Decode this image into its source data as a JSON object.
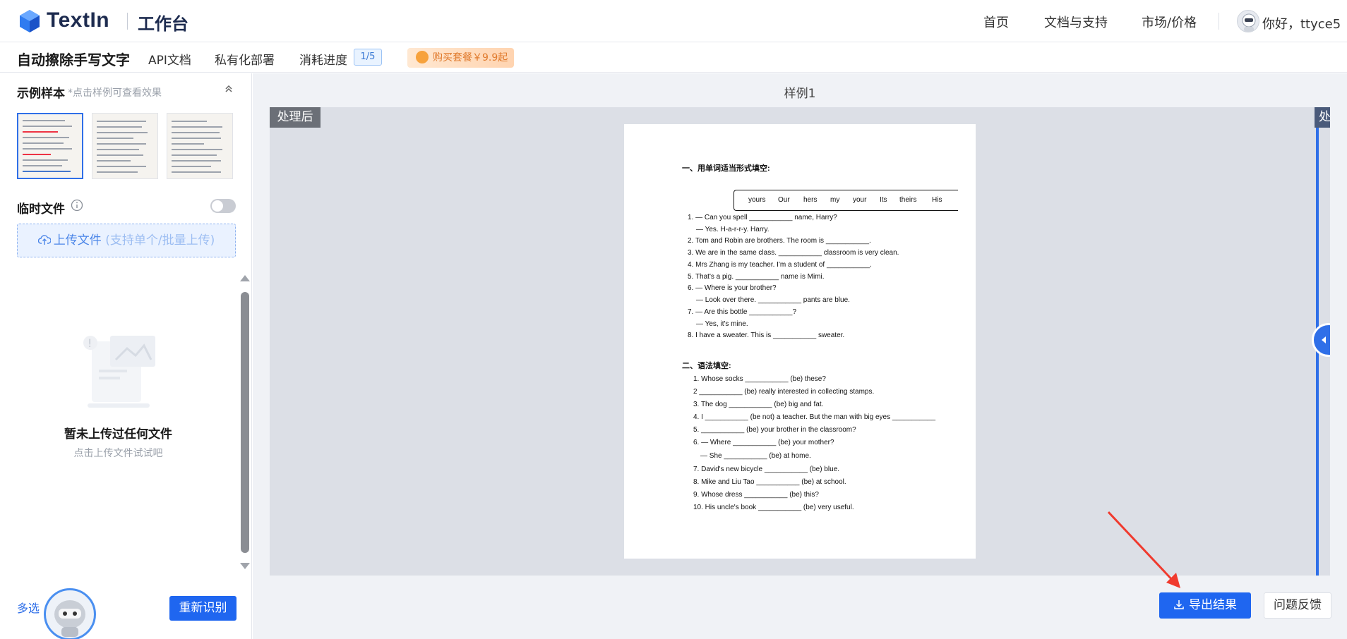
{
  "header": {
    "brand": "TextIn",
    "subtitle": "工作台",
    "nav": [
      "首页",
      "文档与支持",
      "市场/价格"
    ],
    "greeting": "你好，ttyce5"
  },
  "subheader": {
    "title": "自动擦除手写文字",
    "links": [
      "API文档",
      "私有化部署",
      "消耗进度"
    ],
    "progress": "1/5",
    "buy_label": "购买套餐￥9.9起"
  },
  "sidebar": {
    "samples_title": "示例样本",
    "samples_hint": "*点击样例可查看效果",
    "temp_files_title": "临时文件",
    "temp_toggle_on": false,
    "upload_label": "上传文件",
    "upload_note": "(支持单个/批量上传)",
    "empty_title": "暂未上传过任何文件",
    "empty_subtitle": "点击上传文件试试吧",
    "multi_select": "多选",
    "re_recognize": "重新识别"
  },
  "main": {
    "sample_title": "样例1",
    "badge_after": "处理后",
    "badge_before": "处",
    "export_button": "导出结果",
    "feedback_button": "问题反馈"
  },
  "document": {
    "section1": "一、用单词适当形式填空:",
    "word_bank": [
      "yours",
      "Our",
      "hers",
      "my",
      "your",
      "Its",
      "theirs",
      "His"
    ],
    "lines1": [
      "1. — Can you spell ___________ name, Harry?",
      "— Yes. H-a-r-r-y. Harry.",
      "2. Tom and Robin are brothers. The room is ___________.",
      "3. We are in the same class. ___________ classroom is very clean.",
      "4. Mrs Zhang is my teacher. I'm a student of ___________.",
      "5. That's a pig. ___________ name is Mimi.",
      "6. — Where is your brother?",
      "— Look over there. ___________ pants are blue.",
      "7. — Are this bottle ___________?",
      "— Yes, it's mine.",
      "8. I have a sweater. This is ___________ sweater."
    ],
    "section2": "二、语法填空:",
    "lines2": [
      "1. Whose socks ___________ (be) these?",
      "2 ___________ (be) really interested in collecting stamps.",
      "3. The dog ___________ (be) big and fat.",
      "4. I ___________ (be not) a teacher. But the man with big eyes ___________",
      "5. ___________ (be) your brother in the classroom?",
      "6. — Where ___________ (be) your mother?",
      "— She ___________ (be) at home.",
      "7. David's new bicycle ___________ (be) blue.",
      "8. Mike and Liu Tao ___________ (be) at school.",
      "9. Whose dress ___________ (be) this?",
      "10. His uncle's book ___________ (be) very useful."
    ]
  },
  "colors": {
    "accent": "#1f66f0",
    "brand_dark": "#1d2b4f",
    "buy_orange": "#e07a2c"
  }
}
